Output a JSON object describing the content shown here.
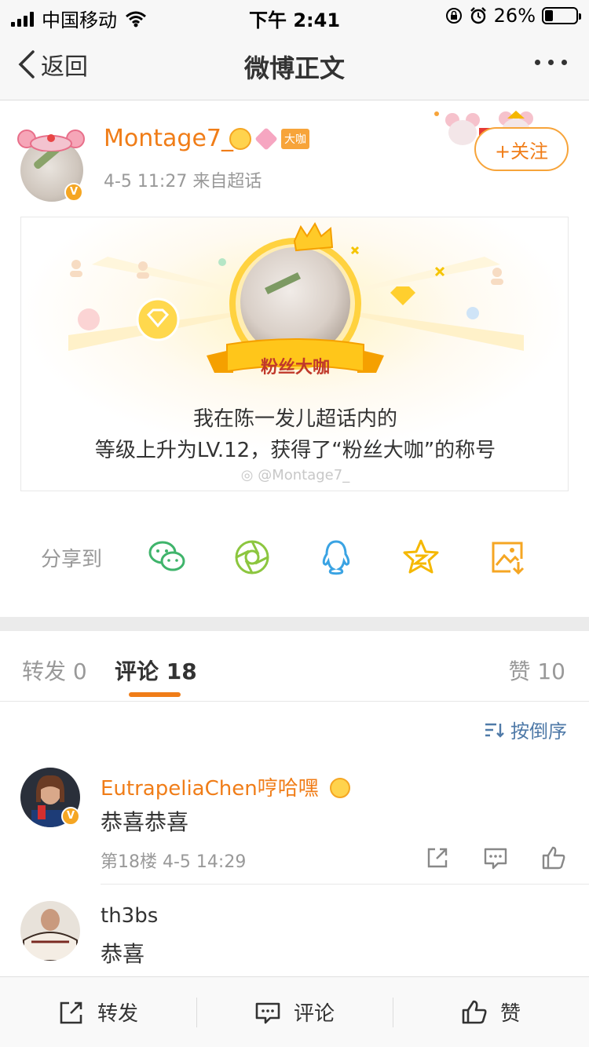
{
  "status_bar": {
    "carrier": "中国移动",
    "time": "下午 2:41",
    "battery": "26%",
    "battery_level": 0.26
  },
  "nav": {
    "back_label": "返回",
    "title": "微博正文"
  },
  "post": {
    "author": "Montage7_",
    "level_badge_text": "大咖",
    "meta": "4-5 11:27  来自超话",
    "follow_label": "+关注",
    "card": {
      "ribbon_text": "粉丝大咖",
      "line1": "我在陈一发儿超话内的",
      "line2": "等级上升为LV.12，获得了“粉丝大咖”的称号",
      "watermark": "@Montage7_"
    }
  },
  "share": {
    "label": "分享到",
    "targets": [
      "wechat-icon",
      "moments-icon",
      "qq-icon",
      "qzone-icon",
      "save-image-icon"
    ]
  },
  "tabs": {
    "repost": "转发 0",
    "comments": "评论 18",
    "likes": "赞 10"
  },
  "sort": {
    "label": "按倒序"
  },
  "comments": [
    {
      "name": "EutrapeliaChen哼哈嘿",
      "text": "恭喜恭喜",
      "meta": "第18楼  4-5 14:29",
      "name_color": "#f07d18"
    },
    {
      "name": "th3bs",
      "text": "恭喜",
      "name_color": "#333333"
    }
  ],
  "bottom_bar": {
    "repost": "转发",
    "comment": "评论",
    "like": "赞"
  },
  "colors": {
    "accent": "#f07d18",
    "link": "#4f7aa8"
  }
}
